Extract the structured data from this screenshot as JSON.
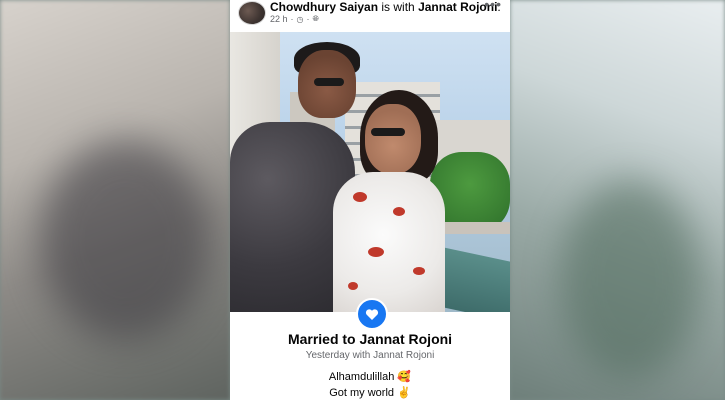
{
  "post": {
    "author": "Chowdhury Saiyan",
    "with_word": "is with",
    "tagged": "Jannat Rojoni",
    "period": ".",
    "time": "22 h",
    "dot": "·",
    "more_label": "•••"
  },
  "life_event": {
    "icon": "heart-icon",
    "title": "Married to Jannat Rojoni",
    "subtitle": "Yesterday with Jannat Rojoni"
  },
  "caption": {
    "line1": "Alhamdulillah",
    "line1_emoji": "🥰",
    "line2": "Got my world",
    "line2_emoji": "✌"
  },
  "colors": {
    "accent": "#1877f2",
    "text_primary": "#050505",
    "text_secondary": "#65676b"
  }
}
